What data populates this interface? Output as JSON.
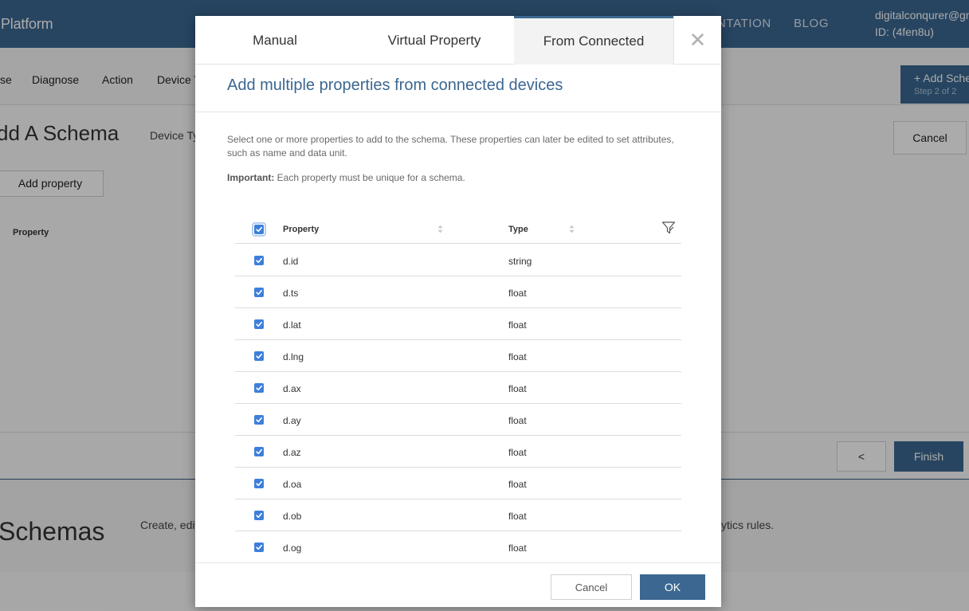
{
  "header": {
    "brand": "Platform",
    "nav": [
      "NTATION",
      "BLOG"
    ],
    "user_email": "digitalconqurer@gm",
    "user_id": "ID: (4fen8u)"
  },
  "subnav": {
    "items": [
      "se",
      "Diagnose",
      "Action",
      "Device T"
    ],
    "add_schema": "+ Add Sche",
    "step": "Step 2 of 2"
  },
  "wizard": {
    "title": "dd A Schema",
    "tab": "Device Ty",
    "cancel": "Cancel",
    "add_property": "Add property",
    "column": "Property",
    "prev": "<",
    "finish": "Finish"
  },
  "schemas": {
    "title": "Schemas",
    "desc_left": "Create, edit",
    "desc_right": "ytics rules."
  },
  "modal": {
    "tabs": [
      "Manual",
      "Virtual Property",
      "From Connected"
    ],
    "active_tab": 2,
    "close_glyph": "✕",
    "title": "Add multiple properties from connected devices",
    "description": "Select one or more properties to add to the schema. These properties can later be edited to set attributes, such as name and data unit.",
    "important_label": "Important:",
    "important_text": " Each property must be unique for a schema.",
    "table": {
      "columns": [
        "Property",
        "Type"
      ],
      "select_all": true,
      "rows": [
        {
          "property": "d.id",
          "type": "string",
          "checked": true
        },
        {
          "property": "d.ts",
          "type": "float",
          "checked": true
        },
        {
          "property": "d.lat",
          "type": "float",
          "checked": true
        },
        {
          "property": "d.lng",
          "type": "float",
          "checked": true
        },
        {
          "property": "d.ax",
          "type": "float",
          "checked": true
        },
        {
          "property": "d.ay",
          "type": "float",
          "checked": true
        },
        {
          "property": "d.az",
          "type": "float",
          "checked": true
        },
        {
          "property": "d.oa",
          "type": "float",
          "checked": true
        },
        {
          "property": "d.ob",
          "type": "float",
          "checked": true
        },
        {
          "property": "d.og",
          "type": "float",
          "checked": true
        }
      ]
    },
    "footer": {
      "cancel": "Cancel",
      "ok": "OK"
    }
  },
  "colors": {
    "primary": "#3b6791",
    "checkbox": "#3d7fdb",
    "title": "#3b6791"
  }
}
